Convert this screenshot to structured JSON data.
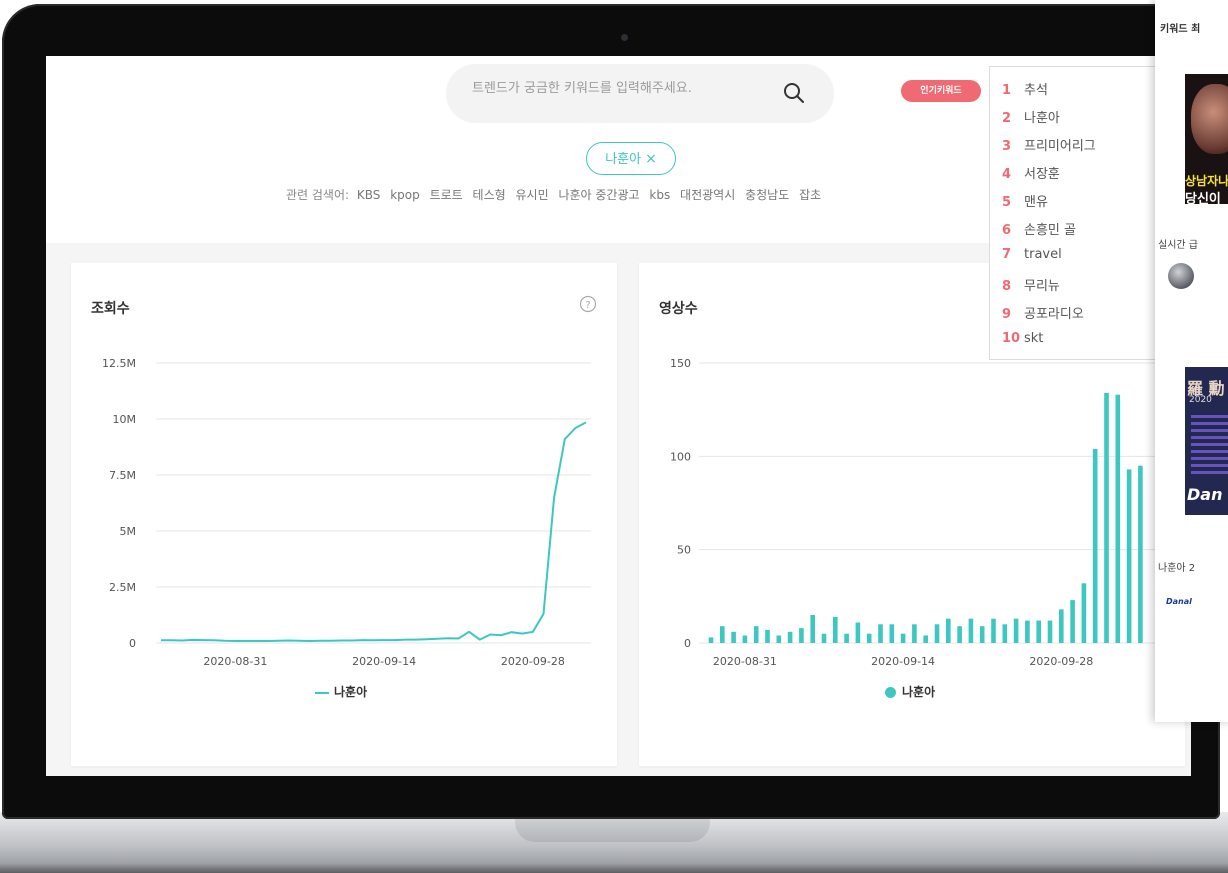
{
  "search": {
    "placeholder": "트렌드가 궁금한 키워드를 입력해주세요."
  },
  "hot_keywords_button": "인기키워드",
  "keyword_chip": {
    "label": "나훈아",
    "close": "×"
  },
  "related": {
    "label": "관련 검색어:",
    "items": [
      "KBS",
      "kpop",
      "트로트",
      "테스형",
      "유시민",
      "나훈아 중간광고",
      "kbs",
      "대전광역시",
      "충청남도",
      "잡초"
    ]
  },
  "ranking": [
    {
      "rank": "1",
      "label": "추석"
    },
    {
      "rank": "2",
      "label": "나훈아"
    },
    {
      "rank": "3",
      "label": "프리미어리그"
    },
    {
      "rank": "4",
      "label": "서장훈"
    },
    {
      "rank": "5",
      "label": "맨유"
    },
    {
      "rank": "6",
      "label": "손흥민 골"
    },
    {
      "rank": "7",
      "label": "travel"
    },
    {
      "rank": "8",
      "label": "무리뉴"
    },
    {
      "rank": "9",
      "label": "공포라디오"
    },
    {
      "rank": "10",
      "label": "skt"
    }
  ],
  "colors": {
    "accent": "#3cc7c1",
    "hot": "#f06a73"
  },
  "right_card": {
    "title": "키워드 최",
    "thumb1_text_yellow": "상남자나",
    "thumb1_text_white": "당신이",
    "section_label": "실시간 급",
    "thumb2_title": "羅 勳",
    "thumb2_year": "2020",
    "thumb2_brand": "Dan",
    "video2_title": "나훈아 2",
    "danal_logo": "Danal"
  },
  "chart_data": [
    {
      "type": "line",
      "title": "조회수",
      "series": [
        {
          "name": "나훈아",
          "values": [
            0.12,
            0.12,
            0.11,
            0.14,
            0.13,
            0.12,
            0.1,
            0.09,
            0.09,
            0.09,
            0.09,
            0.1,
            0.11,
            0.1,
            0.09,
            0.1,
            0.1,
            0.11,
            0.11,
            0.13,
            0.12,
            0.13,
            0.13,
            0.15,
            0.15,
            0.17,
            0.19,
            0.21,
            0.2,
            0.5,
            0.15,
            0.38,
            0.35,
            0.48,
            0.42,
            0.5,
            1.3,
            6.5,
            9.1,
            9.6,
            9.85
          ]
        }
      ],
      "x_ticks": [
        "2020-08-31",
        "2020-09-14",
        "2020-09-28"
      ],
      "y_ticks": [
        "0",
        "2.5M",
        "5M",
        "7.5M",
        "10M",
        "12.5M"
      ],
      "ylim": [
        0,
        12.5
      ]
    },
    {
      "type": "bar",
      "title": "영상수",
      "series": [
        {
          "name": "나훈아",
          "values": [
            3,
            9,
            6,
            4,
            9,
            7,
            4,
            6,
            8,
            15,
            5,
            14,
            5,
            11,
            5,
            10,
            10,
            5,
            10,
            4,
            10,
            13,
            9,
            13,
            9,
            13,
            10,
            13,
            12,
            12,
            12,
            18,
            23,
            32,
            104,
            134,
            133,
            93,
            95
          ]
        }
      ],
      "x_ticks": [
        "2020-08-31",
        "2020-09-14",
        "2020-09-28"
      ],
      "y_ticks": [
        "0",
        "50",
        "100",
        "150"
      ],
      "ylim": [
        0,
        150
      ]
    }
  ]
}
